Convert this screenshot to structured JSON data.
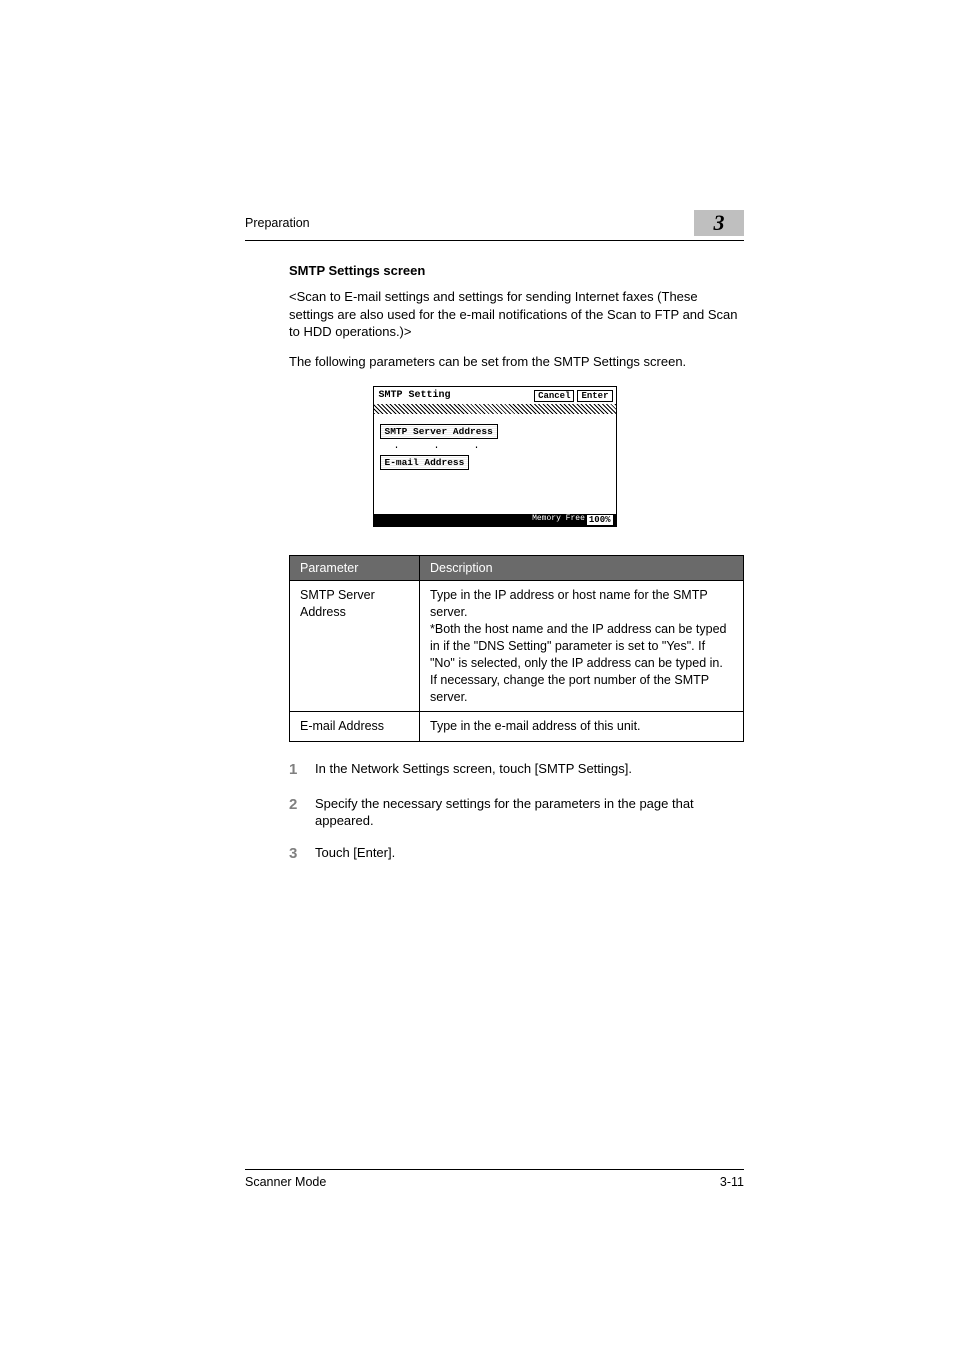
{
  "header": {
    "section": "Preparation",
    "chapter": "3"
  },
  "section_title": "SMTP Settings screen",
  "intro1": "<Scan to E-mail settings and settings for sending Internet faxes (These settings are also used for the e-mail notifications of the Scan to FTP and Scan to HDD operations.)>",
  "intro2": "The following parameters can be set from the SMTP Settings screen.",
  "screenshot": {
    "title": "SMTP Setting",
    "cancel": "Cancel",
    "enter": "Enter",
    "field1": "SMTP Server Address",
    "field2": "E-mail Address",
    "dots": "...",
    "mem_label": "Memory Free",
    "mem_value": "100%"
  },
  "table": {
    "head_param": "Parameter",
    "head_desc": "Description",
    "rows": [
      {
        "param": "SMTP Server Address",
        "desc": "Type in the IP address or host name for the SMTP server.\n*Both the host name and the IP address can be typed in if the \"DNS Setting\" parameter is set to \"Yes\". If \"No\" is selected, only the IP address can be typed in.\nIf necessary, change the port number of the SMTP server."
      },
      {
        "param": "E-mail Address",
        "desc": "Type in the e-mail address of this unit."
      }
    ]
  },
  "steps": [
    "In the Network Settings screen, touch [SMTP Settings].",
    "Specify the necessary settings for the parameters in the page that appeared.",
    "Touch [Enter]."
  ],
  "footer": {
    "left": "Scanner Mode",
    "right": "3-11"
  }
}
